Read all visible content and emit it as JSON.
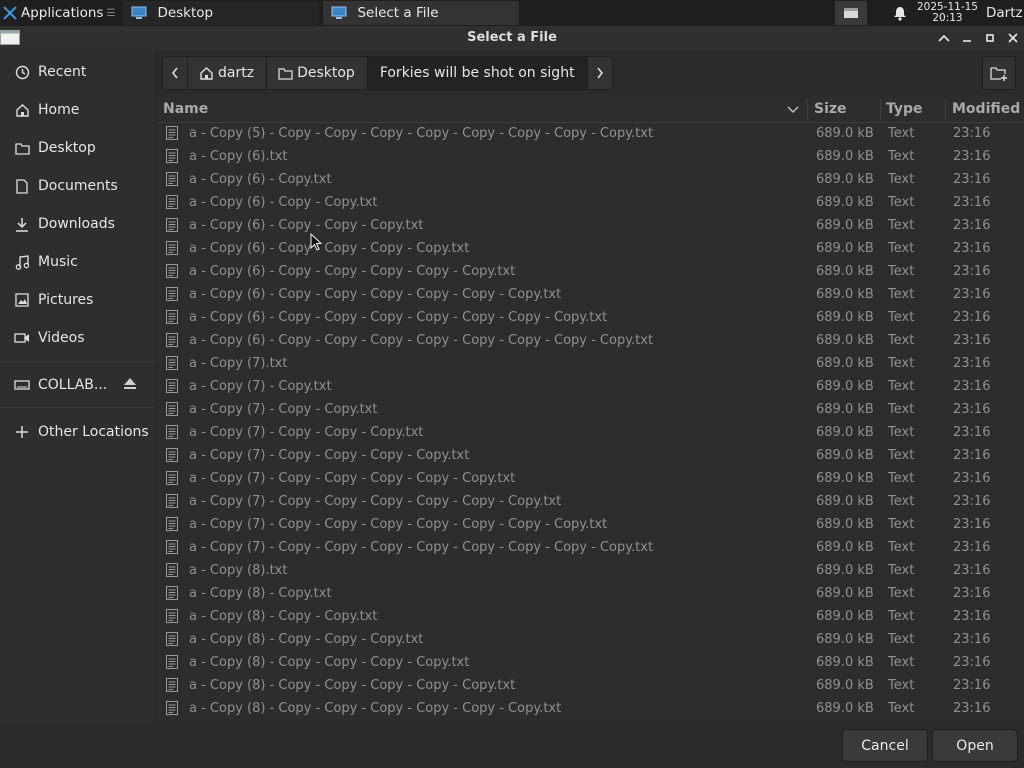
{
  "taskbar": {
    "apps_label": "Applications",
    "tasks": [
      "Desktop",
      "Select a File"
    ],
    "clock_date": "2025-11-15",
    "clock_time": "20:13",
    "user": "Dartz"
  },
  "dialog": {
    "title": "Select a File"
  },
  "sidebar": {
    "items": [
      {
        "label": "Recent",
        "icon": "clock-icon"
      },
      {
        "label": "Home",
        "icon": "home-icon"
      },
      {
        "label": "Desktop",
        "icon": "folder-icon"
      },
      {
        "label": "Documents",
        "icon": "document-icon"
      },
      {
        "label": "Downloads",
        "icon": "download-icon"
      },
      {
        "label": "Music",
        "icon": "music-icon"
      },
      {
        "label": "Pictures",
        "icon": "picture-icon"
      },
      {
        "label": "Videos",
        "icon": "video-icon"
      },
      {
        "label": "COLLAB...",
        "icon": "drive-icon"
      },
      {
        "label": "Other Locations",
        "icon": "plus-icon"
      }
    ]
  },
  "pathbar": {
    "crumbs": [
      "dartz",
      "Desktop",
      "Forkies will be shot on sight"
    ]
  },
  "columns": {
    "name": "Name",
    "size": "Size",
    "type": "Type",
    "modified": "Modified"
  },
  "files": [
    {
      "name": "a - Copy (5) - Copy - Copy - Copy - Copy - Copy - Copy - Copy - Copy.txt",
      "size": "689.0 kB",
      "type": "Text",
      "modified": "23:16"
    },
    {
      "name": "a - Copy (6).txt",
      "size": "689.0 kB",
      "type": "Text",
      "modified": "23:16"
    },
    {
      "name": "a - Copy (6) - Copy.txt",
      "size": "689.0 kB",
      "type": "Text",
      "modified": "23:16"
    },
    {
      "name": "a - Copy (6) - Copy - Copy.txt",
      "size": "689.0 kB",
      "type": "Text",
      "modified": "23:16"
    },
    {
      "name": "a - Copy (6) - Copy - Copy - Copy.txt",
      "size": "689.0 kB",
      "type": "Text",
      "modified": "23:16"
    },
    {
      "name": "a - Copy (6) - Copy - Copy - Copy - Copy.txt",
      "size": "689.0 kB",
      "type": "Text",
      "modified": "23:16"
    },
    {
      "name": "a - Copy (6) - Copy - Copy - Copy - Copy - Copy.txt",
      "size": "689.0 kB",
      "type": "Text",
      "modified": "23:16"
    },
    {
      "name": "a - Copy (6) - Copy - Copy - Copy - Copy - Copy - Copy.txt",
      "size": "689.0 kB",
      "type": "Text",
      "modified": "23:16"
    },
    {
      "name": "a - Copy (6) - Copy - Copy - Copy - Copy - Copy - Copy - Copy.txt",
      "size": "689.0 kB",
      "type": "Text",
      "modified": "23:16"
    },
    {
      "name": "a - Copy (6) - Copy - Copy - Copy - Copy - Copy - Copy - Copy - Copy.txt",
      "size": "689.0 kB",
      "type": "Text",
      "modified": "23:16"
    },
    {
      "name": "a - Copy (7).txt",
      "size": "689.0 kB",
      "type": "Text",
      "modified": "23:16"
    },
    {
      "name": "a - Copy (7) - Copy.txt",
      "size": "689.0 kB",
      "type": "Text",
      "modified": "23:16"
    },
    {
      "name": "a - Copy (7) - Copy - Copy.txt",
      "size": "689.0 kB",
      "type": "Text",
      "modified": "23:16"
    },
    {
      "name": "a - Copy (7) - Copy - Copy - Copy.txt",
      "size": "689.0 kB",
      "type": "Text",
      "modified": "23:16"
    },
    {
      "name": "a - Copy (7) - Copy - Copy - Copy - Copy.txt",
      "size": "689.0 kB",
      "type": "Text",
      "modified": "23:16"
    },
    {
      "name": "a - Copy (7) - Copy - Copy - Copy - Copy - Copy.txt",
      "size": "689.0 kB",
      "type": "Text",
      "modified": "23:16"
    },
    {
      "name": "a - Copy (7) - Copy - Copy - Copy - Copy - Copy - Copy.txt",
      "size": "689.0 kB",
      "type": "Text",
      "modified": "23:16"
    },
    {
      "name": "a - Copy (7) - Copy - Copy - Copy - Copy - Copy - Copy - Copy.txt",
      "size": "689.0 kB",
      "type": "Text",
      "modified": "23:16"
    },
    {
      "name": "a - Copy (7) - Copy - Copy - Copy - Copy - Copy - Copy - Copy - Copy.txt",
      "size": "689.0 kB",
      "type": "Text",
      "modified": "23:16"
    },
    {
      "name": "a - Copy (8).txt",
      "size": "689.0 kB",
      "type": "Text",
      "modified": "23:16"
    },
    {
      "name": "a - Copy (8) - Copy.txt",
      "size": "689.0 kB",
      "type": "Text",
      "modified": "23:16"
    },
    {
      "name": "a - Copy (8) - Copy - Copy.txt",
      "size": "689.0 kB",
      "type": "Text",
      "modified": "23:16"
    },
    {
      "name": "a - Copy (8) - Copy - Copy - Copy.txt",
      "size": "689.0 kB",
      "type": "Text",
      "modified": "23:16"
    },
    {
      "name": "a - Copy (8) - Copy - Copy - Copy - Copy.txt",
      "size": "689.0 kB",
      "type": "Text",
      "modified": "23:16"
    },
    {
      "name": "a - Copy (8) - Copy - Copy - Copy - Copy - Copy.txt",
      "size": "689.0 kB",
      "type": "Text",
      "modified": "23:16"
    },
    {
      "name": "a - Copy (8) - Copy - Copy - Copy - Copy - Copy - Copy.txt",
      "size": "689.0 kB",
      "type": "Text",
      "modified": "23:16"
    }
  ],
  "buttons": {
    "cancel": "Cancel",
    "open": "Open"
  }
}
